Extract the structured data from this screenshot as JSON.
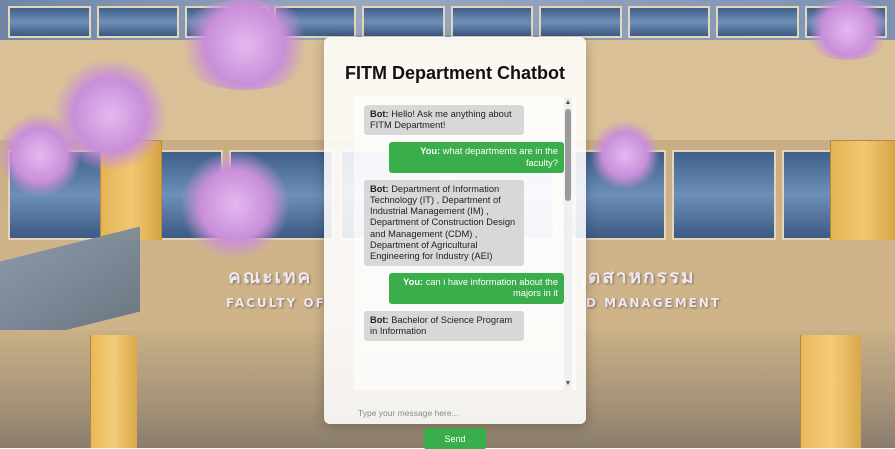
{
  "background": {
    "sign_thai_left": "คณะเทค",
    "sign_thai_right": "ุตสาหกรรม",
    "sign_en_left": "FACULTY OF",
    "sign_en_right": "D MANAGEMENT"
  },
  "chat": {
    "title": "FITM Department Chatbot",
    "messages": [
      {
        "sender": "bot",
        "speaker": "Bot:",
        "text": "Hello! Ask me anything about FITM Department!"
      },
      {
        "sender": "user",
        "speaker": "You:",
        "text": "what departments are in the faculty?"
      },
      {
        "sender": "bot",
        "speaker": "Bot:",
        "text": "Department of Information Technology (IT) , Department of Industrial Management (IM) , Department of Construction Design and Management (CDM) , Department of Agricultural Engineering for Industry (AEI)"
      },
      {
        "sender": "user",
        "speaker": "You:",
        "text": "can i have information about the majors in it"
      },
      {
        "sender": "bot",
        "speaker": "Bot:",
        "text": "Bachelor of Science Program in Information"
      }
    ],
    "input": {
      "value": "",
      "placeholder": "Type your message here..."
    },
    "send_label": "Send",
    "colors": {
      "accent": "#3aae4b",
      "bot_bubble": "#d8d8d8"
    }
  }
}
